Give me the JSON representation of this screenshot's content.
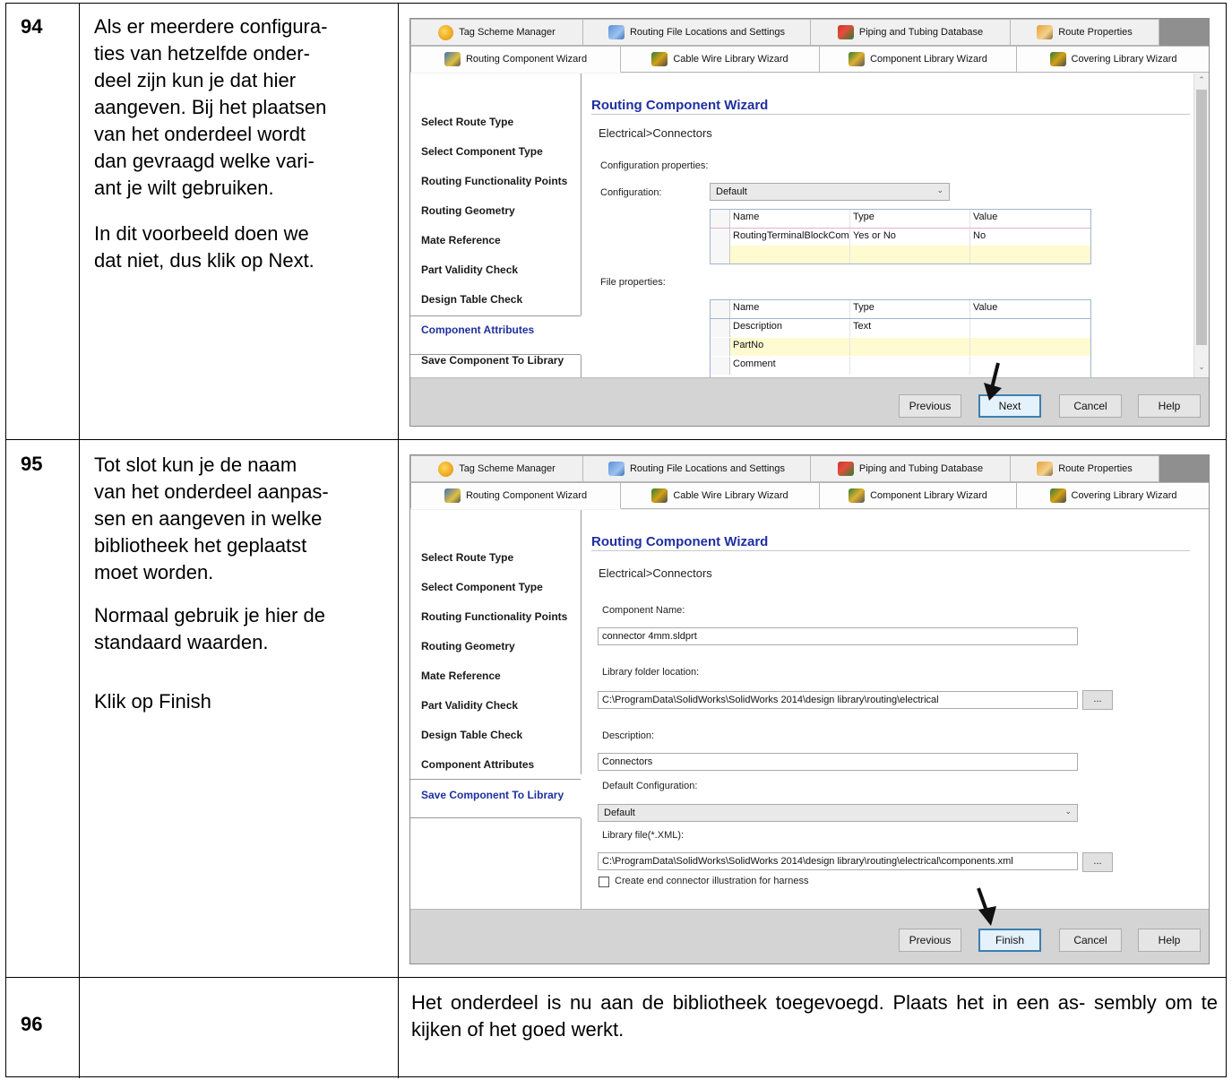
{
  "steps": [
    {
      "number": "94",
      "text": "Als er meerdere configura-\nties van hetzelfde onder-\ndeel zijn kun je dat hier\naangeven. Bij het plaatsen\nvan het onderdeel wordt\ndan gevraagd welke vari-\nant je wilt gebruiken.",
      "text2": "In dit voorbeeld doen we\ndat niet, dus klik op Next."
    },
    {
      "number": "95",
      "text": "Tot slot kun je de naam\nvan het onderdeel aanpas-\nsen en aangeven in welke\nbibliotheek het geplaatst\nmoet worden.",
      "text2": "Normaal gebruik je hier de\nstandaard waarden.",
      "text3": "Klik op Finish"
    },
    {
      "number": "96",
      "text": "Het onderdeel is nu aan de bibliotheek toegevoegd. Plaats het in een as-\nsembly om te kijken of het goed werkt."
    }
  ],
  "tabs_top": [
    "Tag Scheme Manager",
    "Routing File Locations and Settings",
    "Piping and Tubing Database",
    "Route Properties"
  ],
  "tabs_bottom": [
    "Routing Component Wizard",
    "Cable Wire Library Wizard",
    "Component Library Wizard",
    "Covering Library Wizard"
  ],
  "nav_items": [
    "Select Route Type",
    "Select Component Type",
    "Routing Functionality Points",
    "Routing Geometry",
    "Mate Reference",
    "Part Validity Check",
    "Design Table Check",
    "Component Attributes",
    "Save Component To Library"
  ],
  "wizard": {
    "title": "Routing Component Wizard",
    "breadcrumb": "Electrical>Connectors"
  },
  "screen1": {
    "config_props_label": "Configuration properties:",
    "configuration_label": "Configuration:",
    "configuration_value": "Default",
    "grid1": {
      "headers": [
        "Name",
        "Type",
        "Value"
      ],
      "rows": [
        [
          "RoutingTerminalBlockComp",
          "Yes or No",
          "No"
        ]
      ]
    },
    "file_props_label": "File properties:",
    "grid2": {
      "headers": [
        "Name",
        "Type",
        "Value"
      ],
      "rows": [
        [
          "Description",
          "Text",
          ""
        ],
        [
          "PartNo",
          "",
          ""
        ],
        [
          "Comment",
          "",
          ""
        ]
      ]
    },
    "current_step": "Component Attributes"
  },
  "screen2": {
    "component_name_label": "Component Name:",
    "component_name_value": "connector 4mm.sldprt",
    "library_folder_label": "Library folder location:",
    "library_folder_value": "C:\\ProgramData\\SolidWorks\\SolidWorks 2014\\design library\\routing\\electrical",
    "description_label": "Description:",
    "description_value": "Connectors",
    "default_config_label": "Default Configuration:",
    "default_config_value": "Default",
    "library_file_label": "Library file(*.XML):",
    "library_file_value": "C:\\ProgramData\\SolidWorks\\SolidWorks 2014\\design library\\routing\\electrical\\components.xml",
    "harness_checkbox_label": "Create end connector illustration for harness",
    "current_step": "Save Component To Library"
  },
  "buttons": {
    "previous": "Previous",
    "next": "Next",
    "finish": "Finish",
    "cancel": "Cancel",
    "help": "Help",
    "browse": "..."
  },
  "icons": [
    "tag-icon",
    "file-settings-icon",
    "piping-db-icon",
    "route-properties-icon",
    "routing-wizard-icon",
    "cable-wizard-icon",
    "component-wizard-icon",
    "covering-wizard-icon",
    "pointer-arrow-icon",
    "chevron-down-icon"
  ],
  "colors": {
    "accent_title": "#1f2fa0",
    "footer": "#d4d4d4",
    "grid_yellow": "#fffbd0"
  }
}
